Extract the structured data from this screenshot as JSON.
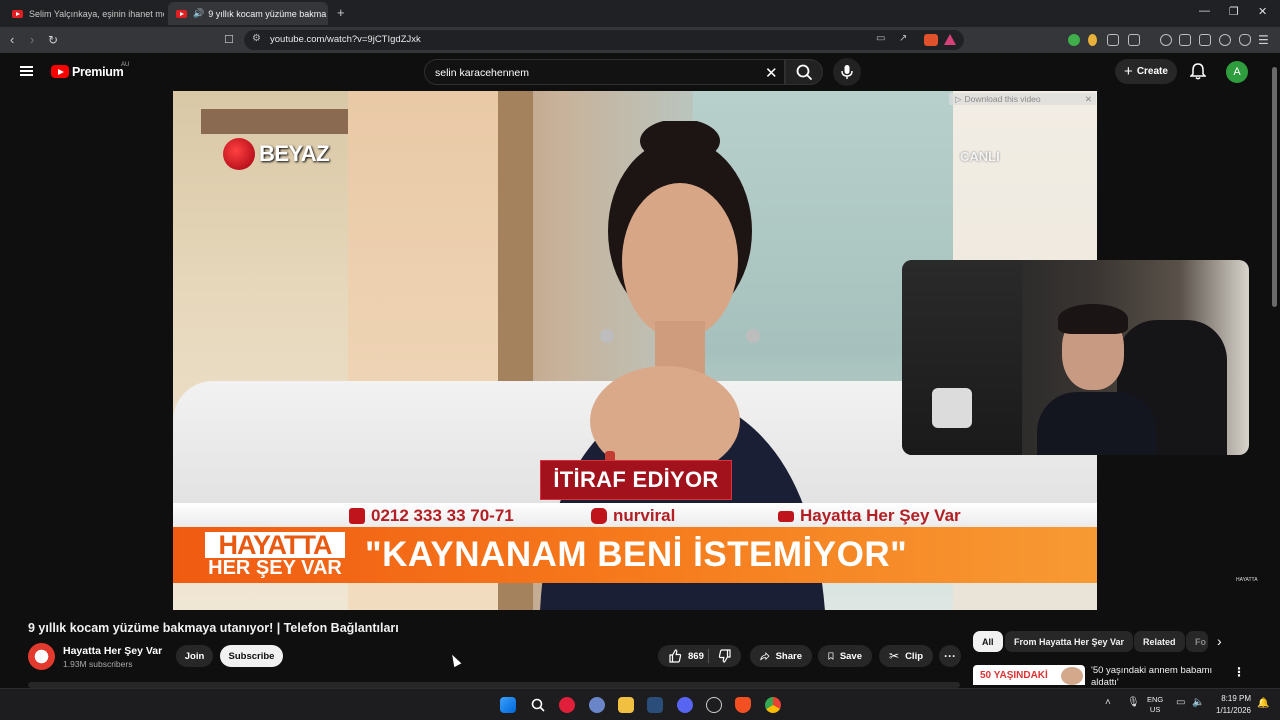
{
  "browser": {
    "tabs": [
      {
        "label": "Selim Yalçınkaya, eşinin ihanet mesaj",
        "active": false
      },
      {
        "label": "9 yıllık kocam yüzüme bakma",
        "active": true
      }
    ],
    "new_tab": "+",
    "url": "youtube.com/watch?v=9jCTIgdZJxk",
    "window_controls": {
      "minimize": "—",
      "restore": "❐",
      "close": "✕"
    }
  },
  "youtube": {
    "brand": "Premium",
    "region": "AU",
    "search": {
      "value": "selin karacehennem",
      "clear": "✕"
    },
    "create_label": "Create",
    "avatar_letter": "A"
  },
  "video_overlay": {
    "channel_logo": "BEYAZ",
    "live": "CANLI",
    "download_label": "Download this video",
    "confession": "İTİRAF EDİYOR",
    "phone": "0212 333 33 70-71",
    "instagram": "nurviral",
    "youtube_channel": "Hayatta Her Şey Var",
    "show_logo_top": "HAYATTA",
    "show_logo_bottom": "HER ŞEY VAR",
    "headline": "\"KAYNANAM BENİ İSTEMİYOR\"",
    "corner_mark": "HAYATTA"
  },
  "video_info": {
    "title": "9 yıllık kocam yüzüme bakmaya utanıyor! | Telefon Bağlantıları",
    "channel_name": "Hayatta Her Şey Var",
    "subscribers": "1.93M subscribers",
    "join_label": "Join",
    "subscribe_label": "Subscribe",
    "likes": "869",
    "share_label": "Share",
    "save_label": "Save",
    "clip_label": "Clip",
    "more": "···"
  },
  "sidebar": {
    "chips": [
      {
        "label": "All",
        "active": true
      },
      {
        "label": "From Hayatta Her Şey Var",
        "active": false
      },
      {
        "label": "Related",
        "active": false
      },
      {
        "label": "Fo",
        "active": false
      }
    ],
    "next": "›",
    "recommendation": {
      "thumb_text": "50 YAŞINDAKİ",
      "title": "'50 yaşındaki annem babamı aldattı'",
      "menu": "⋮"
    }
  },
  "taskbar": {
    "lang_top": "ENG",
    "lang_bottom": "US",
    "time": "8:19 PM",
    "date": "1/11/2026"
  },
  "colors": {
    "youtube_red": "#ff0000",
    "background": "#0f0f0f",
    "headline_orange": "#f67a1c",
    "confession_red": "#a2121c",
    "avatar_green": "#2e9d3e"
  }
}
